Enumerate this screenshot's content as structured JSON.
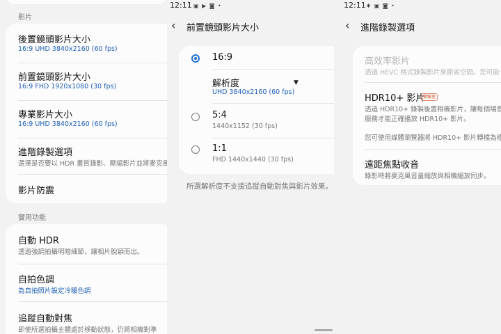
{
  "panel1": {
    "section_video": "影片",
    "items_video": [
      {
        "title": "後置鏡頭影片大小",
        "sub": "16:9 UHD 3840x2160 (60 fps)"
      },
      {
        "title": "前置鏡頭影片大小",
        "sub": "16:9 FHD 1920x1080 (30 fps)"
      },
      {
        "title": "專業影片大小",
        "sub": "16:9 UHD 3840x2160 (60 fps)"
      },
      {
        "title": "進階錄製選項",
        "sub": "選擇是否要以 HDR 畫質錄影、壓縮影片並將麥克風"
      },
      {
        "title": "影片防震"
      }
    ],
    "section_util": "實用功能",
    "items_util": [
      {
        "title": "自動 HDR",
        "sub": "透過強調拍攝明暗細節，讓相片脫穎而出。"
      },
      {
        "title": "自拍色調",
        "sub": "為自拍照片設定冷暖色調"
      },
      {
        "title": "追蹤自動對焦",
        "sub": "即使所選拍攝主體處於移動狀態，仍將相機對準"
      }
    ]
  },
  "panel2": {
    "status_time": "12:11",
    "title": "前置鏡頭影片大小",
    "options": [
      {
        "ratio": "16:9",
        "selected": true
      },
      {
        "ratio": "5:4",
        "res": "1440x1152 (30 fps)",
        "selected": false
      },
      {
        "ratio": "1:1",
        "res": "FHD 1440x1440 (30 fps)",
        "selected": false
      }
    ],
    "resolution_label": "解析度",
    "resolution_value": "UHD 3840x2160 (60 fps)",
    "footer_note": "所選解析度不支援追蹤自動對焦與影片效果。"
  },
  "panel3": {
    "status_time": "12:11",
    "title": "進階錄製選項",
    "hevc": {
      "title": "高效率影片",
      "sub": "透過 HEVC 格式錄製影片來節省空間。您可能"
    },
    "hdr10": {
      "title": "HDR10+ 影片",
      "badge": "實驗室",
      "sub1": "透過 HDR10+ 錄製後置相機影片，讓每個場景",
      "sub2": "服務才能正確播放 HDR10+ 影片。",
      "sub3": "您可使用媒體瀏覽器將 HDR10+ 影片轉檔為標"
    },
    "zoom_mic": {
      "title": "遠距焦點收音",
      "sub": "錄影時將麥克風音量縮放與相機縮放同步。"
    }
  },
  "colors": {
    "accent": "#1f6fd8",
    "link_blue": "#1f5fb8",
    "background": "#f2f2f2",
    "card": "#fcfcfc"
  }
}
